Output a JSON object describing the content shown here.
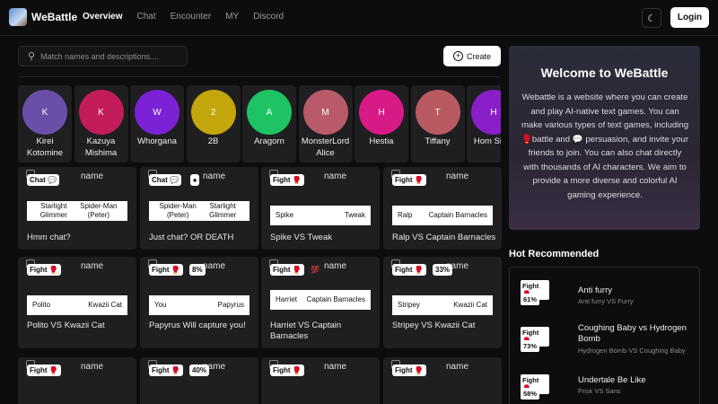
{
  "header": {
    "brand": "WeBattle",
    "nav": [
      "Overview",
      "Chat",
      "Encounter",
      "MY",
      "Discord"
    ],
    "theme_icon": "☾",
    "login_label": "Login"
  },
  "search": {
    "placeholder": "Match names and descriptions....",
    "value": ""
  },
  "create_label": "Create",
  "characters": [
    {
      "initial": "K",
      "name": "Kirei Kotomine",
      "color": "#6a4fa8"
    },
    {
      "initial": "K",
      "name": "Kazuya Mishima",
      "color": "#c21c5a"
    },
    {
      "initial": "W",
      "name": "Whorgana",
      "color": "#7b22d6"
    },
    {
      "initial": "2",
      "name": "2B",
      "color": "#c2a60c"
    },
    {
      "initial": "A",
      "name": "Aragorn",
      "color": "#1ec463"
    },
    {
      "initial": "M",
      "name": "MonsterLord Alice",
      "color": "#b85a6a"
    },
    {
      "initial": "H",
      "name": "Hestia",
      "color": "#d81a86"
    },
    {
      "initial": "T",
      "name": "Tiffany",
      "color": "#b85a60"
    },
    {
      "initial": "H",
      "name": "Hom Simp",
      "color": "#8a1ec8"
    }
  ],
  "cards": [
    {
      "badge": "Chat 💬",
      "pct": "",
      "left": "Starlight Glimmer",
      "right": "Spider-Man (Peter)",
      "title": "Hmm chat?"
    },
    {
      "badge": "Chat 💬",
      "pct": "♠",
      "left": "Spider-Man (Peter)",
      "right": "Starlight Glimmer",
      "title": "Just chat? OR DEATH"
    },
    {
      "badge": "Fight 🥊",
      "pct": "",
      "left": "Spike",
      "right": "Tweak",
      "title": "Spike VS Tweak"
    },
    {
      "badge": "Fight 🥊",
      "pct": "",
      "left": "Ralp",
      "right": "Captain Barnacles",
      "title": "Ralp VS Captain Barnacles"
    },
    {
      "badge": "Fight 🥊",
      "pct": "",
      "left": "Polito",
      "right": "Kwazii Cat",
      "title": "Polito VS Kwazii Cat"
    },
    {
      "badge": "Fight 🥊",
      "pct": "8%",
      "left": "You",
      "right": "Papyrus",
      "title": "Papyrus Will capture you!"
    },
    {
      "badge": "Fight 🥊",
      "pct": "💯",
      "left": "Harriet",
      "right": "Captain Barnacles",
      "title": "Harriet VS Captain Barnacles"
    },
    {
      "badge": "Fight 🥊",
      "pct": "33%",
      "left": "Stripey",
      "right": "Kwazii Cat",
      "title": "Stripey VS Kwazii Cat"
    },
    {
      "badge": "Fight 🥊",
      "pct": "",
      "left": "",
      "right": "",
      "title": ""
    },
    {
      "badge": "Fight 🥊",
      "pct": "40%",
      "left": "",
      "right": "",
      "title": ""
    },
    {
      "badge": "Fight 🥊",
      "pct": "",
      "left": "",
      "right": "",
      "title": ""
    },
    {
      "badge": "Fight 🥊",
      "pct": "",
      "left": "",
      "right": "",
      "title": ""
    }
  ],
  "card_image_alt": "name",
  "welcome": {
    "title": "Welcome to WeBattle",
    "body": "Webattle is a website where you can create and play AI-native text games. You can make various types of text games, including 🥊battle and 💬 persuasion, and invite your friends to join. You can also chat directly with thousands of AI characters. We aim to provide a more diverse and colorful AI gaming experience."
  },
  "hot": {
    "title": "Hot Recommended",
    "items": [
      {
        "badge": "Fight 🥊",
        "pct": "61%",
        "title": "Anti furry",
        "sub": "Anti furry VS Furry"
      },
      {
        "badge": "Fight 🥊",
        "pct": "73%",
        "title": "Coughing Baby vs Hydrogen Bomb",
        "sub": "Hydrogen Bomb VS Coughing Baby"
      },
      {
        "badge": "Fight 🥊",
        "pct": "58%",
        "title": "Undertale Be Like",
        "sub": "Frisk VS Sans"
      }
    ]
  }
}
